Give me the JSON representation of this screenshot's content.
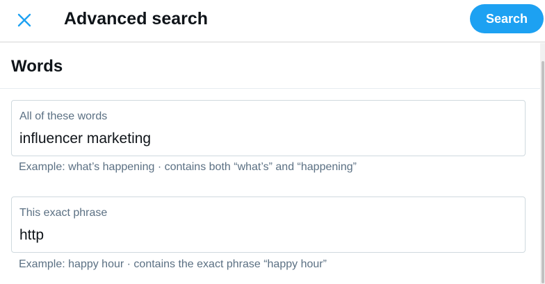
{
  "header": {
    "title": "Advanced search",
    "search_label": "Search"
  },
  "section": {
    "title": "Words"
  },
  "fields": [
    {
      "label": "All of these words",
      "value": "influencer marketing",
      "hint": "Example: what’s happening · contains both “what’s” and “happening”"
    },
    {
      "label": "This exact phrase",
      "value": "http",
      "hint": "Example: happy hour · contains the exact phrase “happy hour”"
    }
  ],
  "colors": {
    "accent": "#1da1f2",
    "text": "#0f1419",
    "muted": "#5b7083",
    "border": "#cfd9de"
  },
  "icons": {
    "close": "close-icon"
  }
}
